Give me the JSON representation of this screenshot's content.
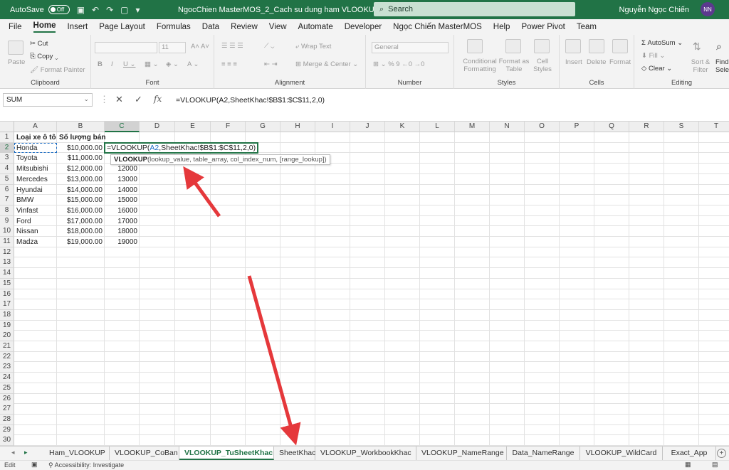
{
  "titlebar": {
    "autosave_label": "AutoSave",
    "autosave_state": "Off",
    "title": "NgocChien MasterMOS_2_Cach su dung ham VLOOKUP_Phan_1 ⌄",
    "search_placeholder": "Search",
    "user_name": "Nguyễn Ngọc Chiến",
    "user_initials": "NN"
  },
  "menu": [
    "File",
    "Home",
    "Insert",
    "Page Layout",
    "Formulas",
    "Data",
    "Review",
    "View",
    "Automate",
    "Developer",
    "Ngọc Chiến MasterMOS",
    "Help",
    "Power Pivot",
    "Team"
  ],
  "ribbon": {
    "clipboard": {
      "label": "Clipboard",
      "paste": "Paste",
      "cut": "Cut",
      "copy": "Copy",
      "format_painter": "Format Painter"
    },
    "font": {
      "label": "Font",
      "size": "11"
    },
    "alignment": {
      "label": "Alignment",
      "wrap": "Wrap Text",
      "merge": "Merge & Center"
    },
    "number": {
      "label": "Number",
      "format": "General"
    },
    "styles": {
      "label": "Styles",
      "conditional": "Conditional Formatting",
      "format_table": "Format as Table",
      "cell_styles": "Cell Styles"
    },
    "cells": {
      "label": "Cells",
      "insert": "Insert",
      "delete": "Delete",
      "format": "Format"
    },
    "editing": {
      "label": "Editing",
      "autosum": "AutoSum",
      "fill": "Fill",
      "clear": "Clear",
      "sort": "Sort & Filter",
      "find": "Find & Select"
    }
  },
  "formula_bar": {
    "name_box": "SUM",
    "formula": "=VLOOKUP(A2,SheetKhac!$B$1:$C$11,2,0)"
  },
  "columns": [
    "A",
    "B",
    "C",
    "D",
    "E",
    "F",
    "G",
    "H",
    "I",
    "J",
    "K",
    "L",
    "M",
    "N",
    "O",
    "P",
    "Q",
    "R",
    "S",
    "T"
  ],
  "headers": {
    "a": "Loại xe ô tô",
    "b": "Số lượng bán"
  },
  "rows": [
    {
      "a": "Honda",
      "b": "$10,000.00",
      "c": ""
    },
    {
      "a": "Toyota",
      "b": "$11,000.00",
      "c": "11000"
    },
    {
      "a": "Mitsubishi",
      "b": "$12,000.00",
      "c": "12000"
    },
    {
      "a": "Mercedes",
      "b": "$13,000.00",
      "c": "13000"
    },
    {
      "a": "Hyundai",
      "b": "$14,000.00",
      "c": "14000"
    },
    {
      "a": "BMW",
      "b": "$15,000.00",
      "c": "15000"
    },
    {
      "a": "Vinfast",
      "b": "$16,000.00",
      "c": "16000"
    },
    {
      "a": "Ford",
      "b": "$17,000.00",
      "c": "17000"
    },
    {
      "a": "Nissan",
      "b": "$18,000.00",
      "c": "18000"
    },
    {
      "a": "Madza",
      "b": "$19,000.00",
      "c": "19000"
    }
  ],
  "editing_cell": {
    "prefix": "=VLOOKUP(",
    "ref": "A2",
    "suffix": ",SheetKhac!$B$1:$C$11,2,0)"
  },
  "tooltip": {
    "fn": "VLOOKUP",
    "args": "(lookup_value, table_array, col_index_num, [range_lookup])"
  },
  "sheets": [
    "Ham_VLOOKUP",
    "VLOOKUP_CoBan",
    "VLOOKUP_TuSheetKhac",
    "SheetKhac",
    "VLOOKUP_WorkbookKhac",
    "VLOOKUP_NameRange",
    "Data_NameRange",
    "VLOOKUP_WildCard",
    "Exact_App"
  ],
  "active_sheet": "VLOOKUP_TuSheetKhac",
  "status": {
    "mode": "Edit",
    "accessibility": "Accessibility: Investigate"
  },
  "colors": {
    "brand": "#217346",
    "arrow": "#e5383b"
  }
}
